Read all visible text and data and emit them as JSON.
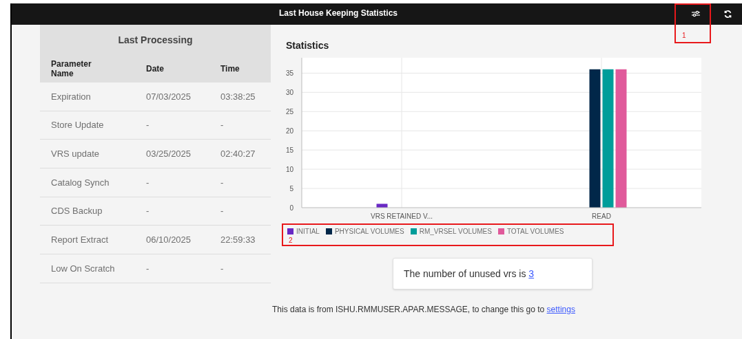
{
  "header": {
    "title": "Last House Keeping Statistics"
  },
  "callouts": [
    {
      "label": "1"
    },
    {
      "label": "2"
    }
  ],
  "last_processing": {
    "title": "Last Processing",
    "columns": [
      "Parameter Name",
      "Date",
      "Time"
    ],
    "rows": [
      [
        "Expiration",
        "07/03/2025",
        "03:38:25"
      ],
      [
        "Store Update",
        "-",
        "-"
      ],
      [
        "VRS update",
        "03/25/2025",
        "02:40:27"
      ],
      [
        "Catalog Synch",
        "-",
        "-"
      ],
      [
        "CDS Backup",
        "-",
        "-"
      ],
      [
        "Report Extract",
        "06/10/2025",
        "22:59:33"
      ],
      [
        "Low On Scratch",
        "-",
        "-"
      ]
    ]
  },
  "statistics": {
    "title": "Statistics",
    "chart_data": {
      "type": "bar",
      "categories": [
        "VRS RETAINED V...",
        "READ"
      ],
      "series": [
        {
          "name": "INITIAL",
          "color": "#6929c4",
          "values": [
            1,
            0
          ]
        },
        {
          "name": "PHYSICAL VOLUMES",
          "color": "#012749",
          "values": [
            0,
            36
          ]
        },
        {
          "name": "RM_VRSEL VOLUMES",
          "color": "#009d9a",
          "values": [
            0,
            36
          ]
        },
        {
          "name": "TOTAL VOLUMES",
          "color": "#e05a9b",
          "values": [
            0,
            36
          ]
        }
      ],
      "ylim": [
        0,
        39
      ],
      "grid": true,
      "yticks": [
        0,
        5,
        10,
        15,
        20,
        25,
        30,
        35
      ]
    }
  },
  "unused_card": {
    "text": "The number of unused vrs is",
    "link": "3"
  },
  "footer": {
    "text": "This data is from ISHU.RMMUSER.APAR.MESSAGE, to change this go to",
    "link": "settings"
  }
}
